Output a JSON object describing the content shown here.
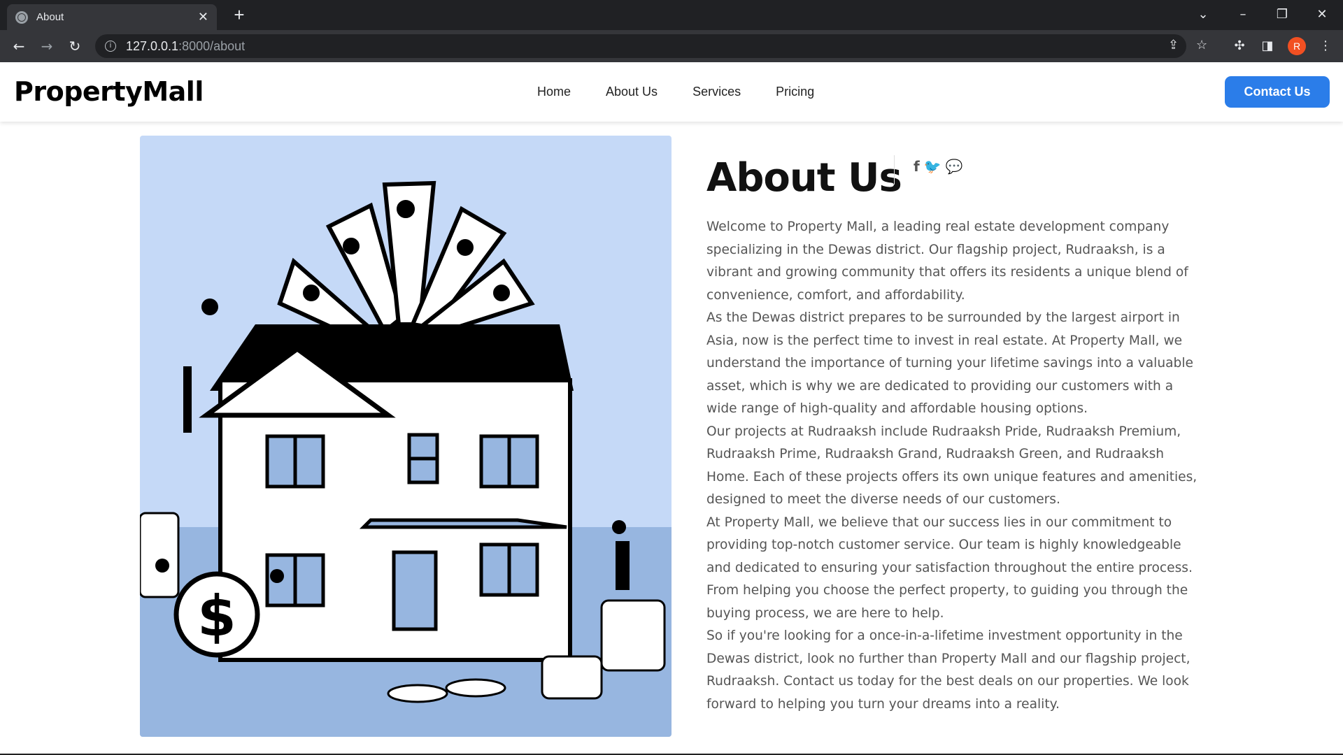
{
  "browser": {
    "tab_title": "About",
    "tab_close": "✕",
    "new_tab": "+",
    "url_host": "127.0.0.1",
    "url_path": ":8000/about",
    "avatar_letter": "R",
    "icons": [
      "back-arrow-icon",
      "forward-arrow-icon",
      "reload-icon",
      "site-info-icon",
      "share-icon",
      "star-icon",
      "extensions-icon",
      "side-panel-icon",
      "menu-icon"
    ]
  },
  "site": {
    "brand": "PropertyMall",
    "nav": [
      "Home",
      "About Us",
      "Services",
      "Pricing"
    ],
    "cta": "Contact Us",
    "accent_color": "#2b7de9"
  },
  "about": {
    "title": "About Us",
    "socials": [
      "f",
      "twitter-icon",
      "chat-icon"
    ],
    "paragraphs": [
      "Welcome to Property Mall, a leading real estate development company specializing in the Dewas district. Our flagship project, Rudraaksh, is a vibrant and growing community that offers its residents a unique blend of convenience, comfort, and affordability.",
      "As the Dewas district prepares to be surrounded by the largest airport in Asia, now is the perfect time to invest in real estate. At Property Mall, we understand the importance of turning your lifetime savings into a valuable asset, which is why we are dedicated to providing our customers with a wide range of high-quality and affordable housing options.",
      "Our projects at Rudraaksh include Rudraaksh Pride, Rudraaksh Premium, Rudraaksh Prime, Rudraaksh Grand, Rudraaksh Green, and Rudraaksh Home. Each of these projects offers its own unique features and amenities, designed to meet the diverse needs of our customers.",
      "At Property Mall, we believe that our success lies in our commitment to providing top-notch customer service. Our team is highly knowledgeable and dedicated to ensuring your satisfaction throughout the entire process. From helping you choose the perfect property, to guiding you through the buying process, we are here to help.",
      "So if you're looking for a once-in-a-lifetime investment opportunity in the Dewas district, look no further than Property Mall and our flagship project, Rudraaksh. Contact us today for the best deals on our properties. We look forward to helping you turn your dreams into a reality."
    ]
  }
}
